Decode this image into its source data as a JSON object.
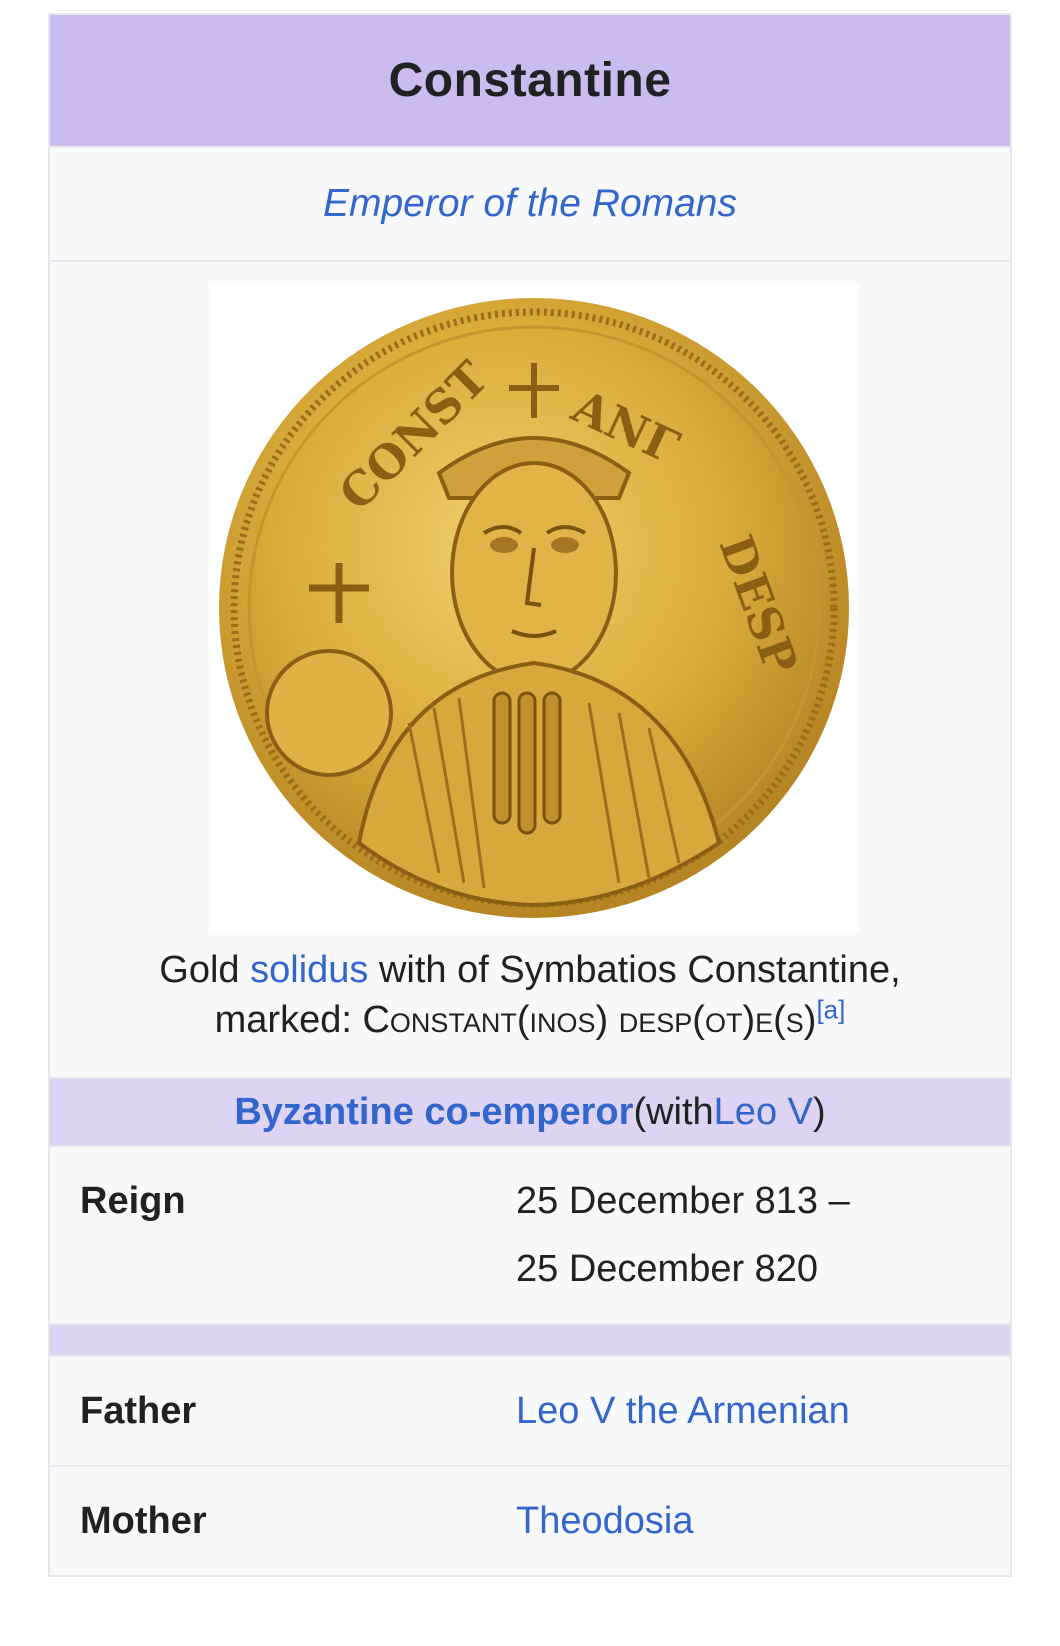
{
  "infobox": {
    "title": "Constantine",
    "subtitle": "Emperor of the Romans",
    "caption": {
      "pre": "Gold ",
      "link": "solidus",
      "post": " with of Symbatios Constantine,",
      "line2_pre": "marked: ",
      "line2_sc": "Constant(inos) desp(ot)e(s)",
      "note": "[a]"
    },
    "section": {
      "title": "Byzantine co-emperor",
      "with_pre": " (with ",
      "with_link": "Leo V",
      "with_post": ")"
    },
    "rows": [
      {
        "label": "Reign",
        "value_line1": "25 December 813 –",
        "value_line2": "25 December 820"
      },
      {
        "label": "Father",
        "value": "Leo V the Armenian"
      },
      {
        "label": "Mother",
        "value": "Theodosia"
      }
    ],
    "colors": {
      "header": "#ccbbee",
      "section": "#ddd3f3",
      "link": "#3366cc",
      "background": "#f8f9fa"
    },
    "image": {
      "description_icon": "gold-solidus-coin"
    }
  }
}
